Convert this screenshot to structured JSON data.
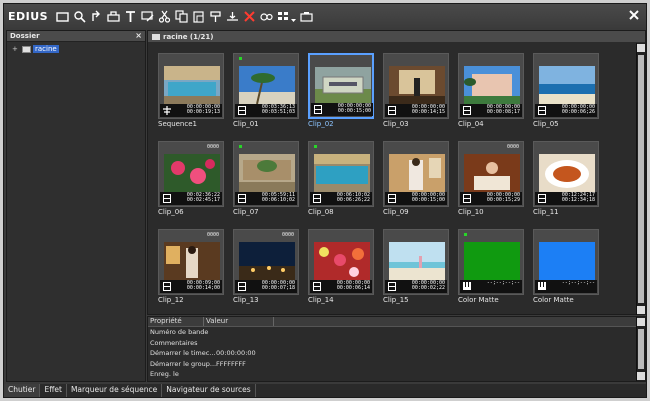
{
  "app": {
    "title": "EDIUS"
  },
  "toolbar": {
    "icons": [
      "new-folder-icon",
      "search-icon",
      "up-folder-icon",
      "open-folder-icon",
      "title-icon",
      "edit-icon",
      "cut-icon",
      "copy-icon",
      "paste-icon",
      "add-in-icon",
      "add-out-icon",
      "delete-icon",
      "properties-icon",
      "view-icon",
      "dropdown-icon",
      "capture-icon"
    ]
  },
  "folder_panel": {
    "title": "Dossier",
    "close": "×",
    "root": {
      "expander": "+",
      "label": "racine"
    }
  },
  "bin": {
    "title": "racine (1/21)"
  },
  "clips": [
    {
      "name": "Sequence1",
      "tc_in": "00:00:00;00",
      "tc_out": "00:00:19;13",
      "type": "sequence",
      "badge": "",
      "dot": false,
      "thumb": "pool",
      "row": 0,
      "col": 0
    },
    {
      "name": "Clip_01",
      "tc_in": "00:03:36;13",
      "tc_out": "00:03:51;03",
      "type": "video",
      "badge": "",
      "dot": true,
      "thumb": "palm",
      "row": 0,
      "col": 1
    },
    {
      "name": "Clip_02",
      "tc_in": "00:00:00;00",
      "tc_out": "00:00:15;00",
      "type": "video",
      "badge": "",
      "dot": false,
      "thumb": "sign",
      "row": 0,
      "col": 2,
      "selected": true
    },
    {
      "name": "Clip_03",
      "tc_in": "00:00:00;00",
      "tc_out": "00:00:14;15",
      "type": "video",
      "badge": "",
      "dot": false,
      "thumb": "lobby",
      "row": 0,
      "col": 3
    },
    {
      "name": "Clip_04",
      "tc_in": "00:00:00;00",
      "tc_out": "00:00:08;17",
      "type": "video",
      "badge": "",
      "dot": false,
      "thumb": "hotel",
      "row": 0,
      "col": 4
    },
    {
      "name": "Clip_05",
      "tc_in": "00:00:00;00",
      "tc_out": "00:00:06;26",
      "type": "video",
      "badge": "",
      "dot": false,
      "thumb": "beach",
      "row": 0,
      "col": 5
    },
    {
      "name": "Clip_06",
      "tc_in": "00:02:36;22",
      "tc_out": "00:02:45;17",
      "type": "video",
      "badge": "0000",
      "dot": false,
      "thumb": "flowers",
      "row": 1,
      "col": 0
    },
    {
      "name": "Clip_07",
      "tc_in": "00:05:59;11",
      "tc_out": "00:06:10;02",
      "type": "video",
      "badge": "",
      "dot": true,
      "thumb": "courtyard",
      "row": 1,
      "col": 1
    },
    {
      "name": "Clip_08",
      "tc_in": "00:06:10;02",
      "tc_out": "00:06:26;22",
      "type": "video",
      "badge": "",
      "dot": true,
      "thumb": "pool2",
      "row": 1,
      "col": 2
    },
    {
      "name": "Clip_09",
      "tc_in": "00:00:00;00",
      "tc_out": "00:00:15;00",
      "type": "video",
      "badge": "",
      "dot": false,
      "thumb": "woman",
      "row": 1,
      "col": 3
    },
    {
      "name": "Clip_10",
      "tc_in": "00:00:00;00",
      "tc_out": "00:00:15;29",
      "type": "video",
      "badge": "0000",
      "dot": false,
      "thumb": "dinner",
      "row": 1,
      "col": 4
    },
    {
      "name": "Clip_11",
      "tc_in": "00:12:24;17",
      "tc_out": "00:12:34;18",
      "type": "video",
      "badge": "",
      "dot": false,
      "thumb": "food",
      "row": 1,
      "col": 5
    },
    {
      "name": "Clip_12",
      "tc_in": "00:00:09;00",
      "tc_out": "00:00:14;00",
      "type": "video",
      "badge": "0000",
      "dot": false,
      "thumb": "woman2",
      "row": 2,
      "col": 0
    },
    {
      "name": "Clip_13",
      "tc_in": "00:00:00;00",
      "tc_out": "00:00:07;18",
      "type": "video",
      "badge": "0000",
      "dot": false,
      "thumb": "night",
      "row": 2,
      "col": 1
    },
    {
      "name": "Clip_14",
      "tc_in": "00:00:00;00",
      "tc_out": "00:00:06;14",
      "type": "video",
      "badge": "",
      "dot": false,
      "thumb": "petals",
      "row": 2,
      "col": 2
    },
    {
      "name": "Clip_15",
      "tc_in": "00:00:00;00",
      "tc_out": "00:00:02;22",
      "type": "video",
      "badge": "",
      "dot": false,
      "thumb": "beach2",
      "row": 2,
      "col": 3
    },
    {
      "name": "Color Matte",
      "tc_in": "--;--;--;--",
      "tc_out": "",
      "type": "matte",
      "badge": "",
      "dot": true,
      "thumb": "green",
      "row": 2,
      "col": 4
    },
    {
      "name": "Color Matte",
      "tc_in": "--;--;--;--",
      "tc_out": "",
      "type": "matte",
      "badge": "",
      "dot": false,
      "thumb": "blue",
      "row": 2,
      "col": 5
    }
  ],
  "properties": {
    "col_property": "Propriété",
    "col_value": "Valeur",
    "rows": [
      {
        "key": "Numéro de bande",
        "value": ""
      },
      {
        "key": "Commentaires",
        "value": ""
      },
      {
        "key": "Démarrer le timec...",
        "value": "00:00:00:00"
      },
      {
        "key": "Démarrer le group...",
        "value": "FFFFFFFF"
      },
      {
        "key": "Enreg. le",
        "value": ""
      }
    ]
  },
  "tabs": [
    {
      "label": "Chutier",
      "active": true
    },
    {
      "label": "Effet",
      "active": false
    },
    {
      "label": "Marqueur de séquence",
      "active": false
    },
    {
      "label": "Navigateur de sources",
      "active": false
    }
  ],
  "colors": {
    "selected": "#5aa0ff",
    "dot": "#28d628",
    "folder_highlight": "#3367c7"
  }
}
